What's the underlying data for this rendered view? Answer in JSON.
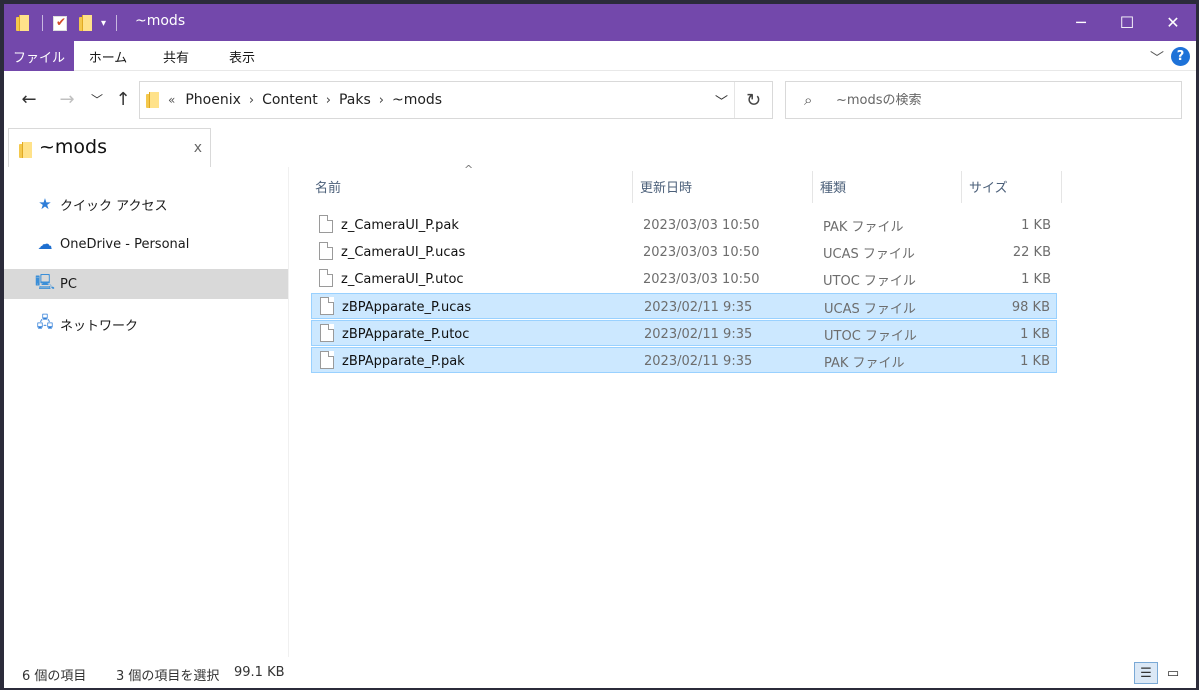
{
  "window": {
    "title": "~mods",
    "minimize_icon": "─",
    "maximize_icon": "☐",
    "close_icon": "✕"
  },
  "ribbon": {
    "tabs": [
      "ファイル",
      "ホーム",
      "共有",
      "表示"
    ],
    "help_label": "?",
    "collapse_icon": "﹀"
  },
  "nav": {
    "back_icon": "←",
    "forward_icon": "→",
    "recent_icon": "﹀",
    "up_icon": "↑",
    "overflow": "«",
    "breadcrumb": [
      "Phoenix",
      "Content",
      "Paks",
      "~mods"
    ],
    "breadcrumb_sep": "›",
    "dropdown_icon": "﹀",
    "refresh_icon": "↻"
  },
  "search": {
    "icon": "⌕",
    "placeholder": "~modsの検索"
  },
  "tab": {
    "label": "~mods",
    "close": "x"
  },
  "sidebar": {
    "items": [
      {
        "label": "クイック アクセス",
        "icon": "★"
      },
      {
        "label": "OneDrive - Personal",
        "icon": "☁"
      },
      {
        "label": "PC",
        "icon": "🖳"
      },
      {
        "label": "ネットワーク",
        "icon": "🖧"
      }
    ]
  },
  "columns": {
    "name": "名前",
    "date": "更新日時",
    "type": "種類",
    "size": "サイズ",
    "sort_arrow": "^"
  },
  "files": [
    {
      "name": "z_CameraUI_P.pak",
      "date": "2023/03/03 10:50",
      "type": "PAK ファイル",
      "size": "1 KB",
      "selected": false
    },
    {
      "name": "z_CameraUI_P.ucas",
      "date": "2023/03/03 10:50",
      "type": "UCAS ファイル",
      "size": "22 KB",
      "selected": false
    },
    {
      "name": "z_CameraUI_P.utoc",
      "date": "2023/03/03 10:50",
      "type": "UTOC ファイル",
      "size": "1 KB",
      "selected": false
    },
    {
      "name": "zBPApparate_P.ucas",
      "date": "2023/02/11 9:35",
      "type": "UCAS ファイル",
      "size": "98 KB",
      "selected": true
    },
    {
      "name": "zBPApparate_P.utoc",
      "date": "2023/02/11 9:35",
      "type": "UTOC ファイル",
      "size": "1 KB",
      "selected": true
    },
    {
      "name": "zBPApparate_P.pak",
      "date": "2023/02/11 9:35",
      "type": "PAK ファイル",
      "size": "1 KB",
      "selected": true
    }
  ],
  "status": {
    "item_count": "6 個の項目",
    "selection": "3 個の項目を選択",
    "selection_size": "99.1 KB",
    "details_view_icon": "☰",
    "large_icons_view_icon": "▭"
  },
  "colors": {
    "titlebar": "#7348ab",
    "selection_bg": "#cce8ff",
    "selection_border": "#99d1ff"
  }
}
